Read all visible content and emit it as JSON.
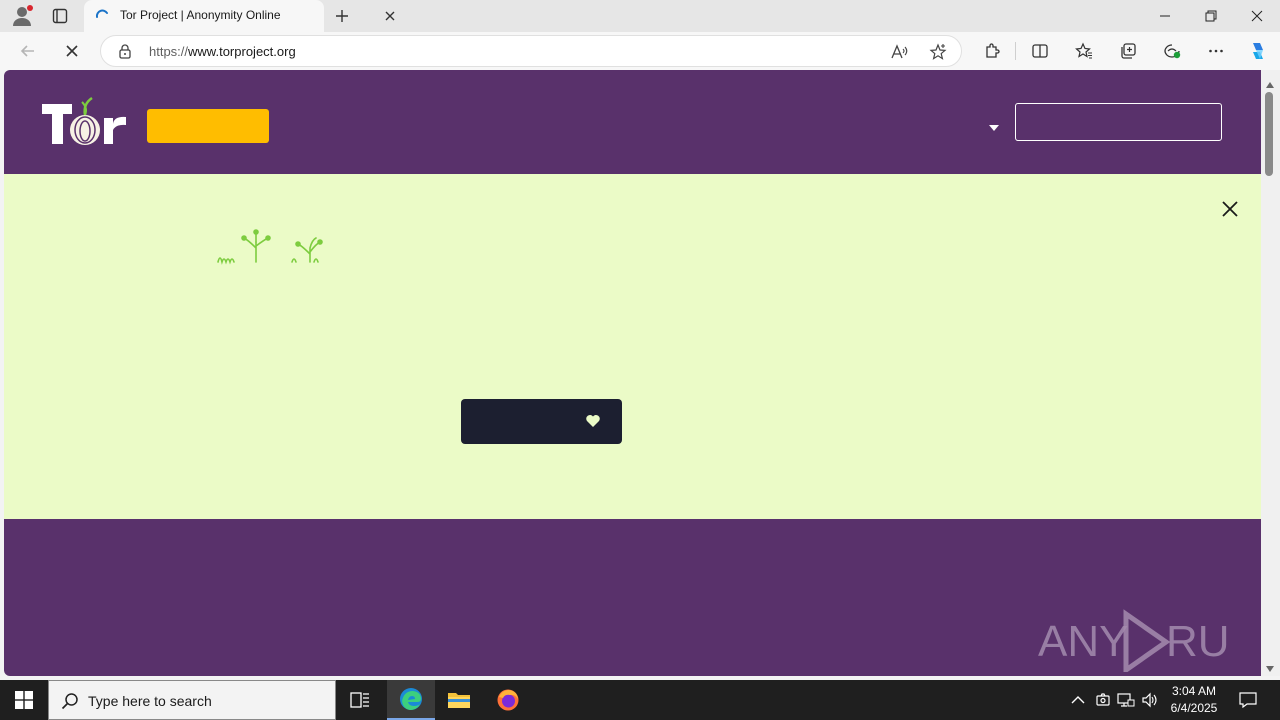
{
  "browser": {
    "tab_title": "Tor Project | Anonymity Online",
    "url_scheme": "https://",
    "url_host": "www.torproject.org"
  },
  "page": {
    "logo_text": "Tor"
  },
  "watermark": {
    "text": "ANY RUN"
  },
  "taskbar": {
    "search_placeholder": "Type here to search",
    "time": "3:04 AM",
    "date": "6/4/2025"
  },
  "colors": {
    "tor_purple": "#59316b",
    "donate_yellow": "#ffbd00",
    "banner_green": "#ebfbc7",
    "dark_button": "#1c1f30",
    "sprout_green": "#7dcc3f"
  }
}
